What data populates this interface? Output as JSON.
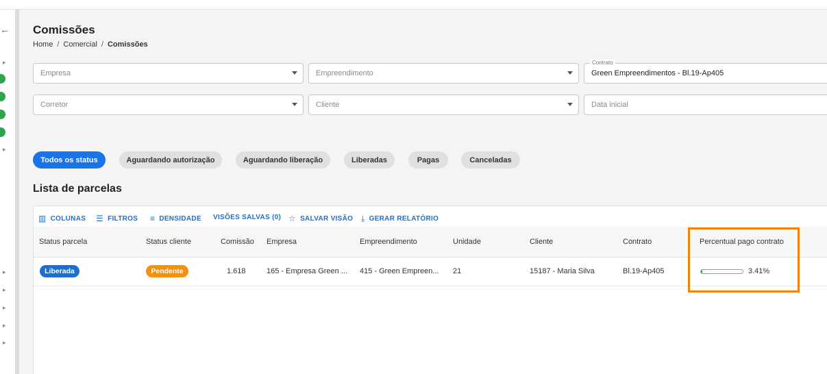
{
  "page": {
    "title": "Comissões",
    "breadcrumb": [
      "Home",
      "Comercial",
      "Comissões"
    ]
  },
  "filters": {
    "empresa": {
      "placeholder": "Empresa"
    },
    "empreendimento": {
      "placeholder": "Empreendimento"
    },
    "contrato": {
      "label": "Contrato",
      "value": "Green Empreendimentos - Bl.19-Ap405"
    },
    "corretor": {
      "placeholder": "Corretor"
    },
    "cliente": {
      "placeholder": "Cliente"
    },
    "data_inicial": {
      "placeholder": "Data inicial"
    }
  },
  "status_chips": [
    {
      "label": "Todos os status",
      "active": true
    },
    {
      "label": "Aguardando autorização",
      "active": false
    },
    {
      "label": "Aguardando liberação",
      "active": false
    },
    {
      "label": "Liberadas",
      "active": false
    },
    {
      "label": "Pagas",
      "active": false
    },
    {
      "label": "Canceladas",
      "active": false
    }
  ],
  "list": {
    "title": "Lista de parcelas",
    "toolbar": {
      "colunas": "COLUNAS",
      "filtros": "FILTROS",
      "densidade": "DENSIDADE",
      "visoes_salvas": "VISÕES SALVAS (0)",
      "salvar_visao": "SALVAR VISÃO",
      "gerar_relatorio": "GERAR RELATÓRIO"
    },
    "columns": [
      "Status parcela",
      "Status cliente",
      "Comissão",
      "Empresa",
      "Empreendimento",
      "Unidade",
      "Cliente",
      "Contrato",
      "Percentual pago contrato"
    ],
    "rows": [
      {
        "status_parcela": "Liberada",
        "status_cliente": "Pendente",
        "comissao": "1.618",
        "empresa": "165 - Empresa Green ...",
        "empreendimento": "415 - Green Empreen...",
        "unidade": "21",
        "cliente": "15187 - Maria Silva",
        "contrato": "Bl.19-Ap405",
        "percentual_label": "3.41%",
        "percentual_value": 3.41
      }
    ]
  },
  "colors": {
    "primary": "#1a73e8",
    "liberada": "#1a6fd1",
    "pendente": "#f5900d",
    "progress": "#2ea44f",
    "highlight": "#f5820d"
  },
  "icons": {
    "back": "←",
    "chevron": "▸",
    "colunas": "▥",
    "filtros": "☰",
    "densidade": "≡",
    "salvar": "☆",
    "relatorio": "⤓"
  }
}
